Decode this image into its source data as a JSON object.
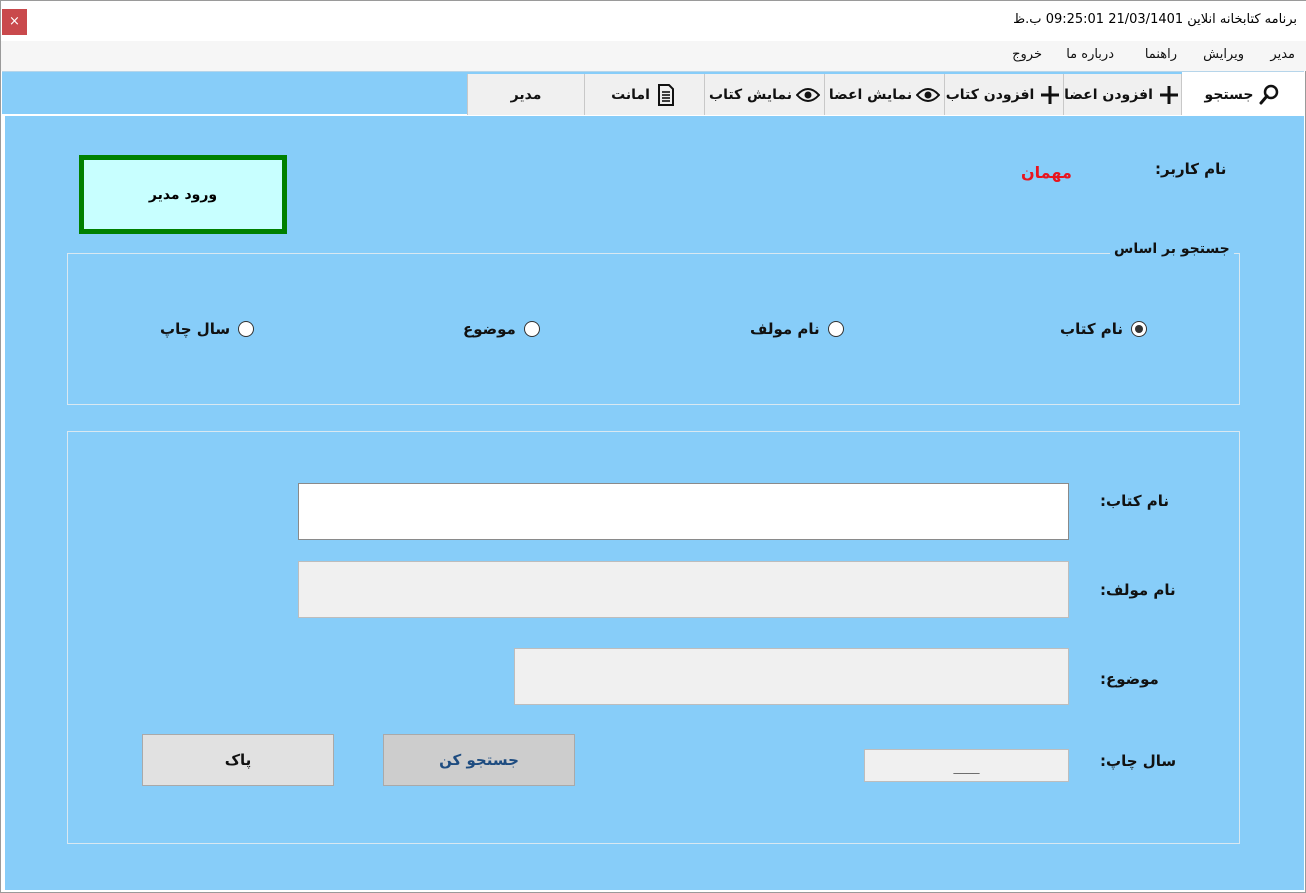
{
  "window": {
    "title": "برنامه کتابخانه انلاین 21/03/1401 09:25:01 ب.ظ",
    "close_glyph": "×"
  },
  "menu": {
    "items": [
      "مدیر",
      "ویرایش",
      "راهنما",
      "درباره ما",
      "خروج"
    ]
  },
  "tabs": [
    {
      "label": "جستجو",
      "icon": "search-icon"
    },
    {
      "label": "افزودن اعضا",
      "icon": "plus-icon"
    },
    {
      "label": "افزودن کتاب",
      "icon": "plus-icon"
    },
    {
      "label": "نمایش اعضا",
      "icon": "eye-icon"
    },
    {
      "label": "نمایش کتاب",
      "icon": "eye-icon"
    },
    {
      "label": "امانت",
      "icon": "document-icon"
    },
    {
      "label": "مدیر",
      "icon": ""
    }
  ],
  "header": {
    "admin_login_label": "ورود مدیر",
    "username_label": "نام کاربر:",
    "username_value": "مهمان"
  },
  "search_by": {
    "title": "جستجو بر اساس",
    "options": [
      {
        "label": "نام کتاب",
        "checked": true
      },
      {
        "label": "نام مولف",
        "checked": false
      },
      {
        "label": "موضوع",
        "checked": false
      },
      {
        "label": "سال چاپ",
        "checked": false
      }
    ]
  },
  "form": {
    "book_name_label": "نام کتاب:",
    "book_name_value": "",
    "author_label": "نام مولف:",
    "author_value": "",
    "subject_label": "موضوع:",
    "subject_value": "",
    "year_label": "سال چاپ:",
    "year_value": "____"
  },
  "buttons": {
    "search_label": "جستجو کن",
    "clear_label": "پاک"
  },
  "colors": {
    "background": "#87cdf9",
    "admin_button_border": "#008000",
    "admin_button_fill": "#c8ffff",
    "guest_text": "#e8141e"
  }
}
